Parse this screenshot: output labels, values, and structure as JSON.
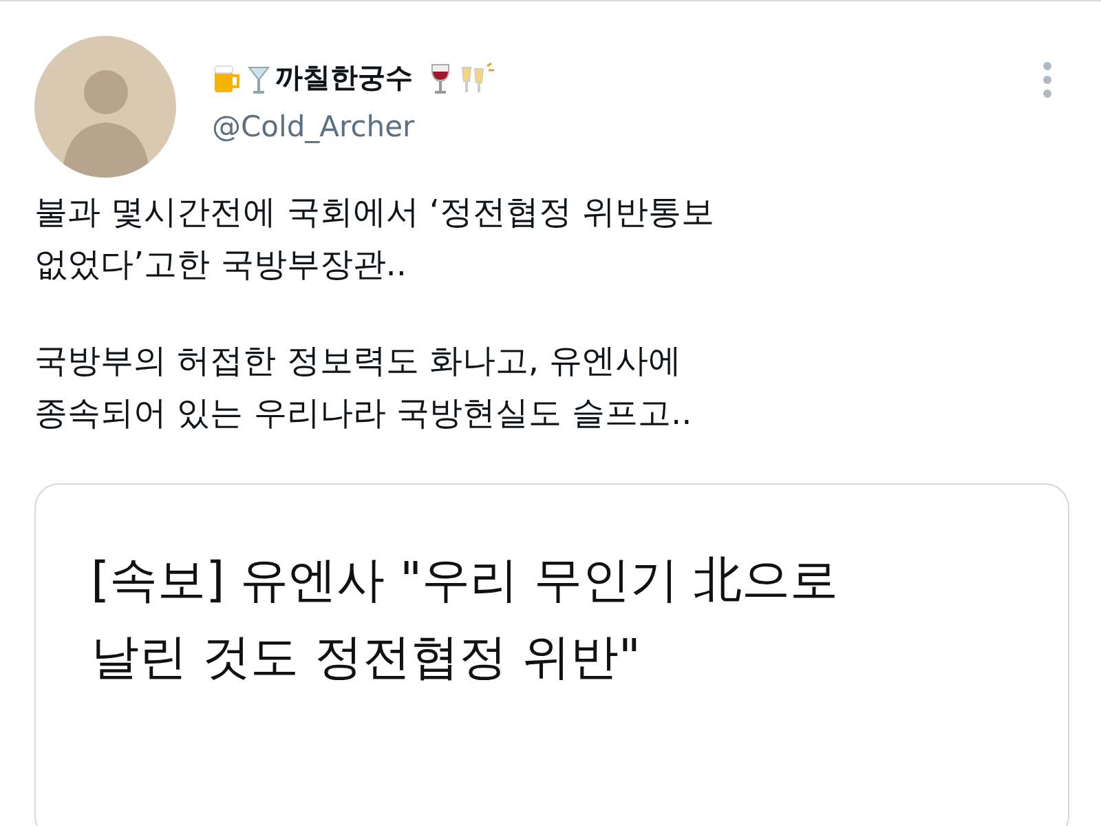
{
  "tweet": {
    "display_name": "까칠한궁수",
    "handle": "@Cold_Archer",
    "paragraphs": [
      [
        "불과 몇시간전에 국회에서 ‘정전협정 위반통보",
        "없었다’고한 국방부장관.."
      ],
      [
        "국방부의 허접한 정보력도 화나고, 유엔사에",
        "종속되어 있는 우리나라 국방현실도 슬프고.."
      ]
    ]
  },
  "link_card": {
    "headline": [
      "[속보] 유엔사 \"우리 무인기 北으로",
      "날린 것도 정전협정 위반\""
    ]
  }
}
